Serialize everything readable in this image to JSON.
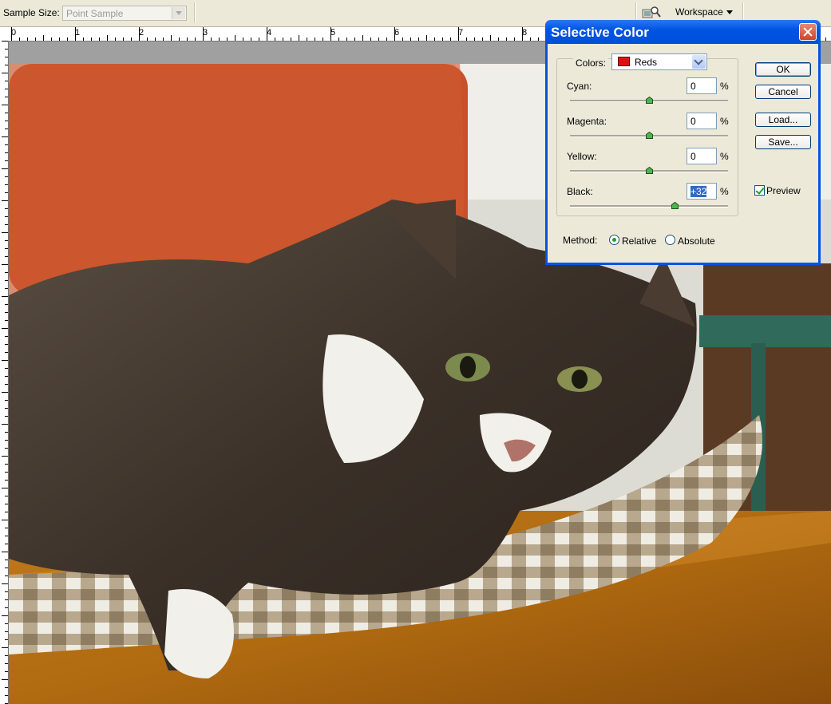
{
  "options_bar": {
    "sample_size_label": "Sample Size:",
    "sample_size_value": "Point Sample",
    "workspace_label": "Workspace"
  },
  "ruler": {
    "labels": [
      "0",
      "1",
      "2",
      "3",
      "4",
      "5",
      "6",
      "7",
      "8"
    ]
  },
  "dialog": {
    "title": "Selective Color",
    "colors_label": "Colors:",
    "colors_value": "Reds",
    "colors_swatch": "#e01010",
    "sliders": [
      {
        "label": "Cyan:",
        "value": "0",
        "unit": "%",
        "level": 0
      },
      {
        "label": "Magenta:",
        "value": "0",
        "unit": "%",
        "level": 0
      },
      {
        "label": "Yellow:",
        "value": "0",
        "unit": "%",
        "level": 0
      },
      {
        "label": "Black:",
        "value": "+32",
        "unit": "%",
        "level": 32
      }
    ],
    "buttons": {
      "ok": "OK",
      "cancel": "Cancel",
      "load": "Load...",
      "save": "Save..."
    },
    "preview_label": "Preview",
    "preview_checked": true,
    "method_label": "Method:",
    "method_options": [
      "Relative",
      "Absolute"
    ],
    "method_selected": "Relative"
  }
}
